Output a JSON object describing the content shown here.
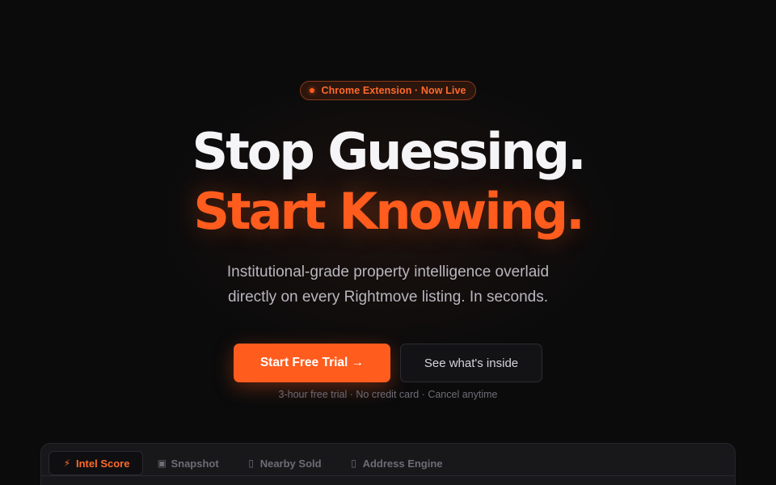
{
  "badge": {
    "label": "Chrome Extension · Now Live"
  },
  "hero": {
    "headline_line1": "Stop Guessing.",
    "headline_line2": "Start Knowing.",
    "subtitle_line1": "Institutional-grade property intelligence overlaid",
    "subtitle_line2": "directly on every Rightmove listing. In seconds."
  },
  "cta": {
    "primary_label": "Start Free Trial →",
    "secondary_label": "See what's inside",
    "fineprint": "3-hour free trial · No credit card · Cancel anytime"
  },
  "preview": {
    "tabs": [
      {
        "icon": "⚡",
        "icon_name": "lightning-icon",
        "label": "Intel Score",
        "active": true
      },
      {
        "icon": "▣",
        "icon_name": "snapshot-icon",
        "label": "Snapshot",
        "active": false
      },
      {
        "icon": "▯",
        "icon_name": "nearby-sold-icon",
        "label": "Nearby Sold",
        "active": false
      },
      {
        "icon": "▯",
        "icon_name": "address-engine-icon",
        "label": "Address Engine",
        "active": false
      }
    ]
  },
  "colors": {
    "accent": "#ff5c1e",
    "background": "#0b0b0c",
    "headline": "#f5f4f7"
  }
}
